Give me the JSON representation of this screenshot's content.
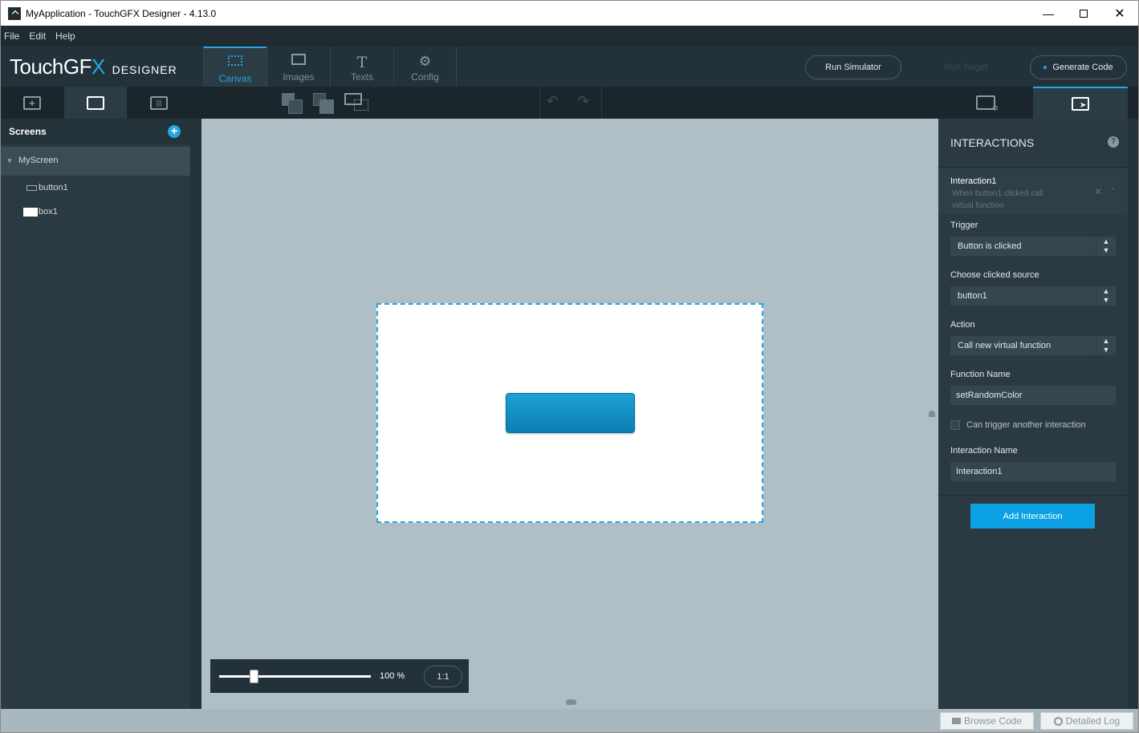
{
  "window": {
    "title": "MyApplication - TouchGFX Designer - 4.13.0"
  },
  "menu": [
    "File",
    "Edit",
    "Help"
  ],
  "logo": {
    "main": "TouchGF",
    "x": "X",
    "sub": "DESIGNER"
  },
  "nav_tabs": [
    {
      "label": "Canvas",
      "icon": "canvas-icon",
      "active": true
    },
    {
      "label": "Images",
      "icon": "image-icon",
      "active": false
    },
    {
      "label": "Texts",
      "icon": "text-icon",
      "active": false
    },
    {
      "label": "Config",
      "icon": "gear-icon",
      "active": false
    }
  ],
  "header_buttons": {
    "run_simulator": "Run Simulator",
    "run_target": "Run Target",
    "generate_code": "Generate Code"
  },
  "screens": {
    "title": "Screens",
    "items": [
      {
        "label": "MyScreen"
      },
      {
        "label": "button1"
      },
      {
        "label": "box1"
      }
    ]
  },
  "zoom": {
    "percent_label": "100 %",
    "ratio_label": "1:1",
    "value": 0.23
  },
  "interactions": {
    "title": "INTERACTIONS",
    "item_name": "Interaction1",
    "item_desc_1": "When button1 clicked call",
    "item_desc_2": "virtual function",
    "trigger_label": "Trigger",
    "trigger_value": "Button is clicked",
    "source_label": "Choose clicked source",
    "source_value": "button1",
    "action_label": "Action",
    "action_value": "Call new virtual function",
    "function_label": "Function Name",
    "function_value": "setRandomColor",
    "chain_label": "Can trigger another interaction",
    "name_label": "Interaction Name",
    "name_value": "Interaction1",
    "add_button": "Add Interaction"
  },
  "status": {
    "browse_code": "Browse Code",
    "detailed_log": "Detailed Log"
  },
  "colors": {
    "accent": "#22a7e0",
    "panel": "#2b3a42",
    "canvas": "#b0bfc5"
  }
}
